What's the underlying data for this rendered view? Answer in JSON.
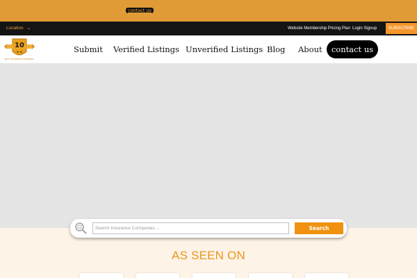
{
  "promo": {
    "contact_label": "contact us"
  },
  "utility_bar": {
    "location_label": "Location",
    "links": [
      "Website Membership Pricing Plan",
      "Login Signup"
    ],
    "subscribe_label": "SUBSCRIBE"
  },
  "logo": {
    "number": "10",
    "caption": "BEST INSURANCE COMPANIES"
  },
  "nav": {
    "items": [
      "Submit",
      "Verified Listings",
      "Unverified Listings",
      "Blog",
      "About"
    ],
    "contact_label": "contact us"
  },
  "search": {
    "placeholder": "Search Insurance Companies ...",
    "value": "",
    "button_label": "Search"
  },
  "as_seen_on": {
    "title": "AS SEEN ON"
  },
  "icons": {
    "search": "magnifier-icon",
    "location_toggle": "chevron-down-icon"
  },
  "colors": {
    "promo_bg": "#e09a36",
    "utility_bg": "#141414",
    "accent": "#f0920f",
    "hero_bg": "#e5e5e5",
    "section_bg": "#fdf3e7",
    "title_orange": "#e9961d"
  }
}
